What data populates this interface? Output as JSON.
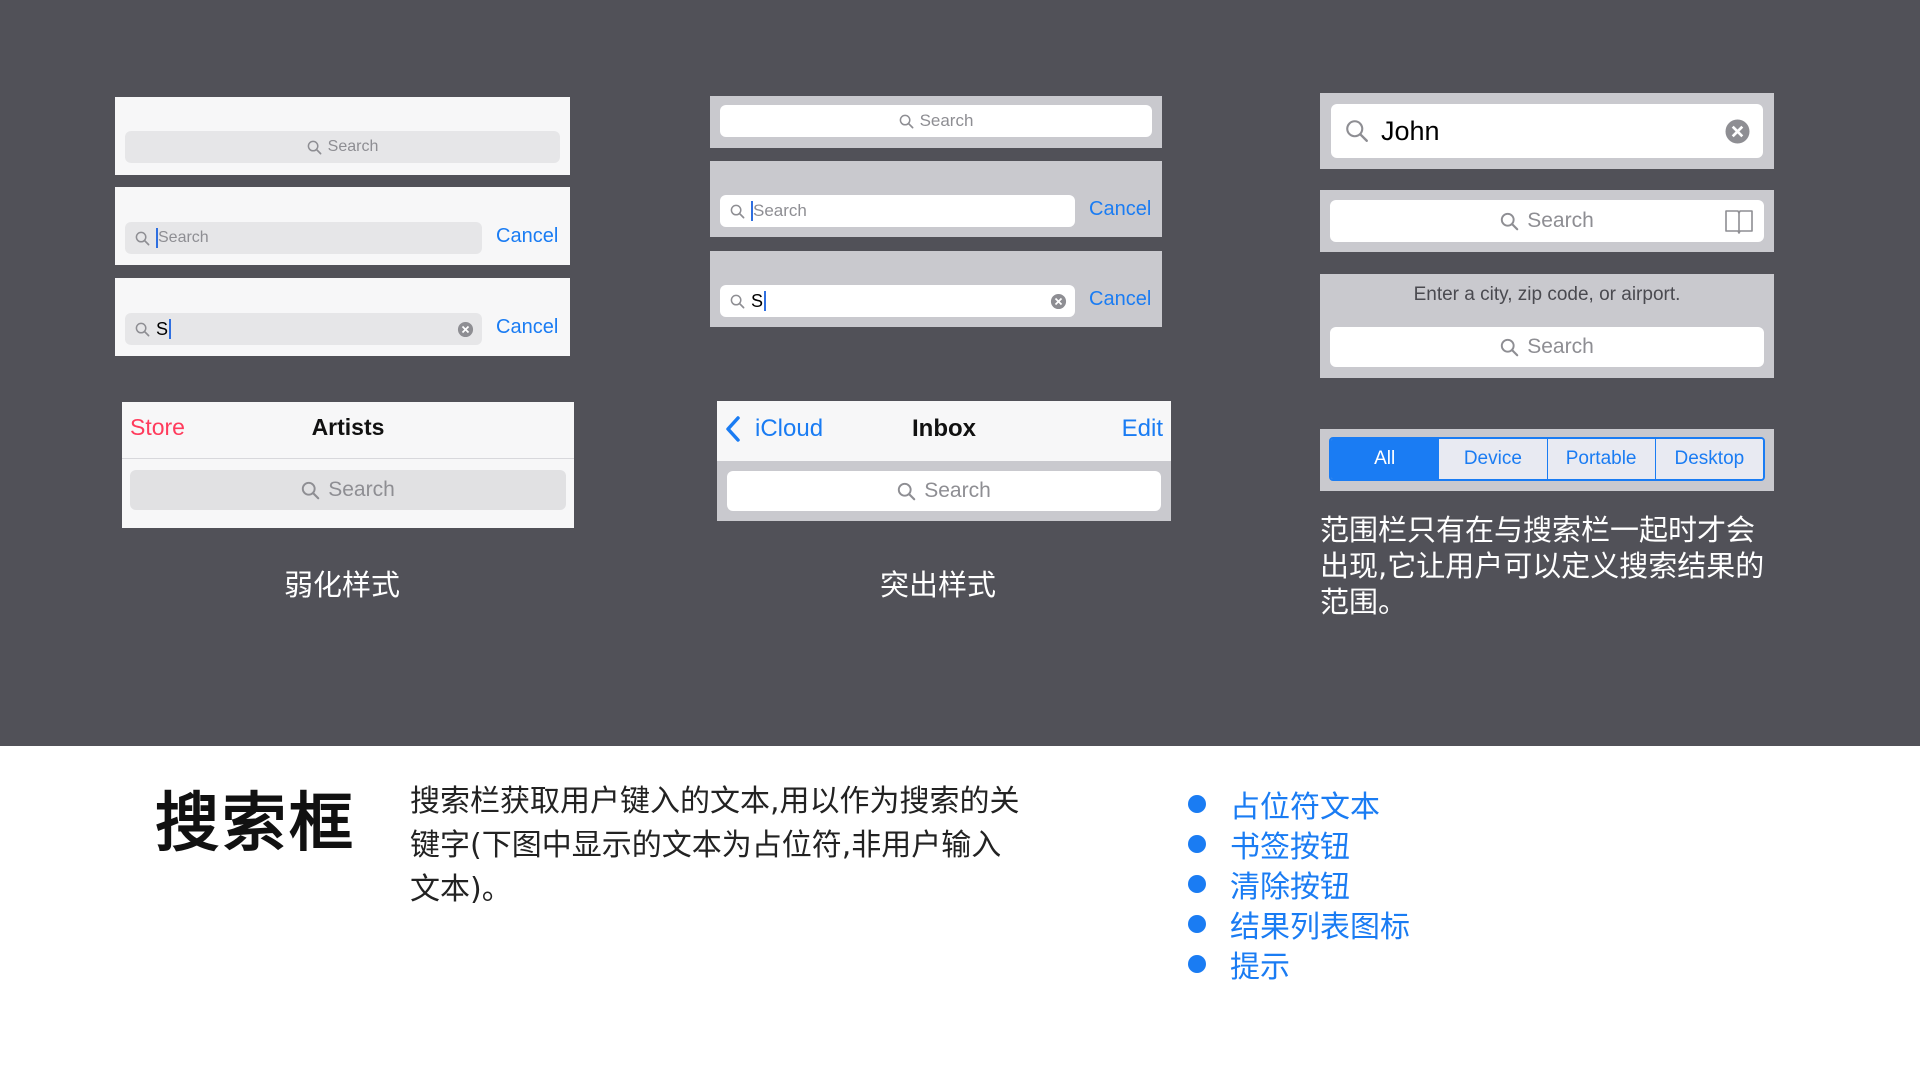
{
  "minimal": {
    "placeholder": "Search",
    "typed": "S",
    "cancel": "Cancel",
    "nav": {
      "left": "Store",
      "title": "Artists",
      "placeholder": "Search"
    },
    "caption": "弱化样式"
  },
  "prominent": {
    "placeholder": "Search",
    "typed": "S",
    "cancel": "Cancel",
    "nav": {
      "back": "iCloud",
      "title": "Inbox",
      "right": "Edit",
      "placeholder": "Search"
    },
    "caption": "突出样式"
  },
  "examples": {
    "query": "John",
    "placeholder": "Search",
    "prompt": "Enter a city, zip code, or airport.",
    "prompt_placeholder": "Search"
  },
  "scope": {
    "options": [
      "All",
      "Device",
      "Portable",
      "Desktop"
    ],
    "selected": "All",
    "description": "范围栏只有在与搜索栏一起时才会出现,它让用户可以定义搜索结果的范围。"
  },
  "footer": {
    "title": "搜索框",
    "description": "搜索栏获取用户键入的文本,用以作为搜索的关键字(下图中显示的文本为占位符,非用户输入文本)。",
    "bullets": [
      "占位符文本",
      "书签按钮",
      "清除按钮",
      "结果列表图标",
      "提示"
    ]
  },
  "colors": {
    "stage": "#515158",
    "accent": "#1a7cf3",
    "store_red": "#ff3b5c",
    "bar_grey": "#c9c9ce",
    "bar_light": "#f7f7f8"
  }
}
